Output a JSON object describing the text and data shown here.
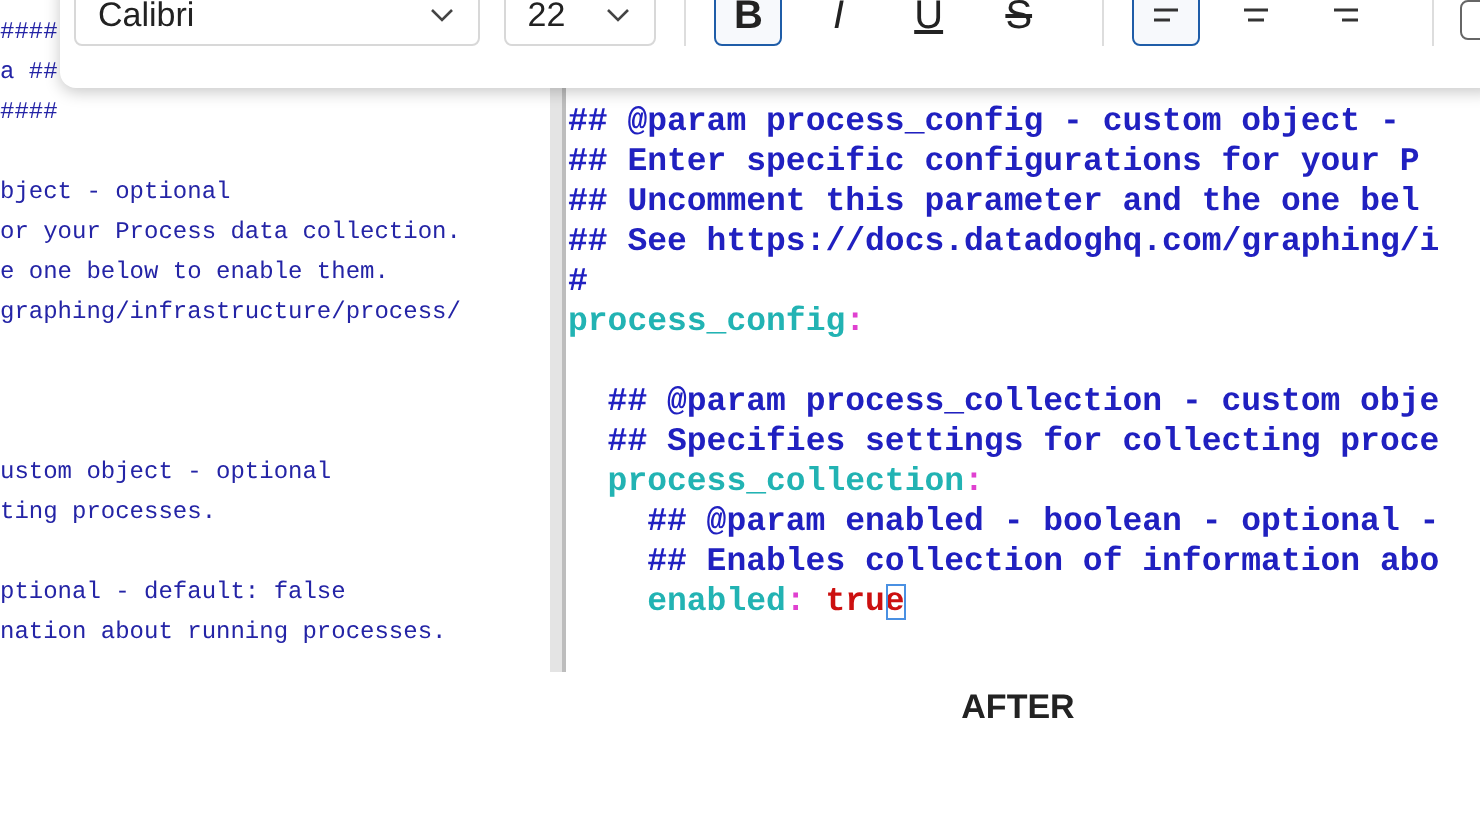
{
  "toolbar": {
    "font": {
      "value": "Calibri"
    },
    "size": {
      "value": "22"
    },
    "format_buttons": [
      {
        "kind": "bold",
        "label": "B",
        "selected": true
      },
      {
        "kind": "italic",
        "label": "I",
        "selected": false
      },
      {
        "kind": "underline",
        "label": "U",
        "selected": false
      },
      {
        "kind": "strikethrough",
        "label": "S",
        "selected": false
      }
    ],
    "align_buttons": [
      {
        "kind": "left",
        "selected": true
      },
      {
        "kind": "center",
        "selected": false
      },
      {
        "kind": "right",
        "selected": false
      }
    ],
    "checkbox": {
      "checked": false
    }
  },
  "before_code": {
    "lines": [
      {
        "kind": "text",
        "text": "####"
      },
      {
        "kind": "text",
        "text": "a ##"
      },
      {
        "kind": "text",
        "text": "####"
      },
      {
        "kind": "blank"
      },
      {
        "kind": "text",
        "text": "bject - optional"
      },
      {
        "kind": "text",
        "text": "or your Process data collection."
      },
      {
        "kind": "text",
        "text": "e one below to enable them."
      },
      {
        "kind": "text",
        "text": "graphing/infrastructure/process/"
      },
      {
        "kind": "blank"
      },
      {
        "kind": "blank"
      },
      {
        "kind": "blank"
      },
      {
        "kind": "text",
        "text": "ustom object - optional"
      },
      {
        "kind": "text",
        "text": "ting processes."
      },
      {
        "kind": "blank"
      },
      {
        "kind": "text",
        "text": "ptional - default: false"
      },
      {
        "kind": "text",
        "text": "nation about running processes."
      }
    ]
  },
  "after_code": {
    "lines": [
      {
        "kind": "comment",
        "text": "## @param process_config - custom object -"
      },
      {
        "kind": "comment",
        "text": "## Enter specific configurations for your P"
      },
      {
        "kind": "comment",
        "text": "## Uncomment this parameter and the one bel"
      },
      {
        "kind": "comment",
        "text": "## See https://docs.datadoghq.com/graphing/i"
      },
      {
        "kind": "comment",
        "text": "#"
      },
      {
        "kind": "key",
        "key": "process_config",
        "separator": ":",
        "children": [
          {
            "kind": "blank"
          },
          {
            "kind": "comment",
            "text": "## @param process_collection - custom obje"
          },
          {
            "kind": "comment",
            "text": "## Specifies settings for collecting proce"
          },
          {
            "kind": "key",
            "key": "process_collection",
            "separator": ":",
            "children": [
              {
                "kind": "comment",
                "text": "## @param enabled - boolean - optional -"
              },
              {
                "kind": "comment",
                "text": "## Enables collection of information abo"
              },
              {
                "kind": "key",
                "key": "enabled",
                "separator": ":",
                "value": "true",
                "caret": true
              }
            ]
          }
        ]
      }
    ]
  },
  "caption": "AFTER"
}
